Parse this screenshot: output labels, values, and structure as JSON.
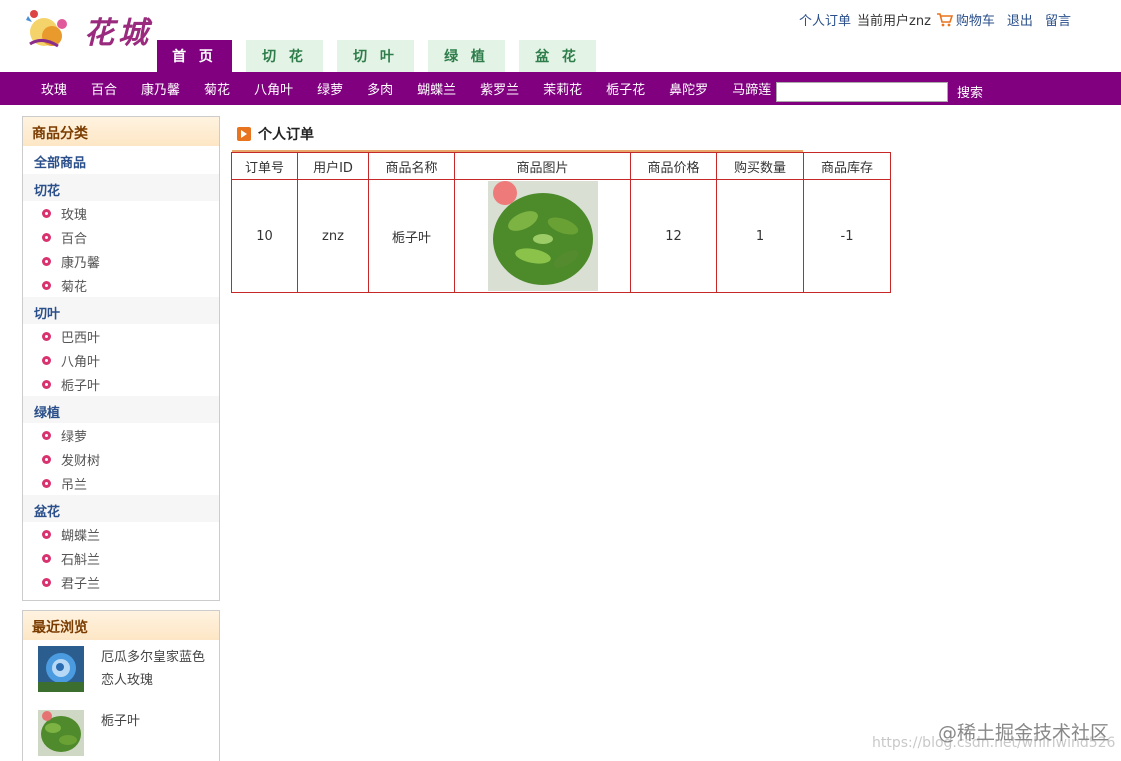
{
  "header": {
    "logo_text": "花城",
    "links": {
      "orders": "个人订单",
      "current_user": "当前用户znz",
      "cart": "购物车",
      "logout": "退出",
      "message": "留言"
    },
    "tabs": [
      "首 页",
      "切 花",
      "切 叶",
      "绿 植",
      "盆 花"
    ]
  },
  "navbar": {
    "items": [
      "玫瑰",
      "百合",
      "康乃馨",
      "菊花",
      "八角叶",
      "绿萝",
      "多肉",
      "蝴蝶兰",
      "紫罗兰",
      "茉莉花",
      "栀子花",
      "鼻陀罗",
      "马蹄莲"
    ],
    "search_value": "",
    "search_button": "搜索"
  },
  "sidebar": {
    "title": "商品分类",
    "all": "全部商品",
    "groups": [
      {
        "name": "切花",
        "items": [
          "玫瑰",
          "百合",
          "康乃馨",
          "菊花"
        ]
      },
      {
        "name": "切叶",
        "items": [
          "巴西叶",
          "八角叶",
          "栀子叶"
        ]
      },
      {
        "name": "绿植",
        "items": [
          "绿萝",
          "发财树",
          "吊兰"
        ]
      },
      {
        "name": "盆花",
        "items": [
          "蝴蝶兰",
          "石斛兰",
          "君子兰"
        ]
      }
    ]
  },
  "recent": {
    "title": "最近浏览",
    "items": [
      {
        "name": "厄瓜多尔皇家蓝色恋人玫瑰"
      },
      {
        "name": "栀子叶"
      }
    ]
  },
  "main": {
    "title": "个人订单",
    "columns": [
      "订单号",
      "用户ID",
      "商品名称",
      "商品图片",
      "商品价格",
      "购买数量",
      "商品库存"
    ],
    "rows": [
      {
        "order_id": "10",
        "user_id": "znz",
        "product_name": "栀子叶",
        "price": "12",
        "quantity": "1",
        "stock": "-1"
      }
    ]
  },
  "watermark": {
    "main": "@稀土掘金技术社区",
    "url": "https://blog.csdn.net/whirlwind526"
  },
  "colors": {
    "brand_purple": "#800080",
    "tab_bg": "#e3f3e6",
    "table_border": "#c62828",
    "link": "#2a4f8a"
  }
}
